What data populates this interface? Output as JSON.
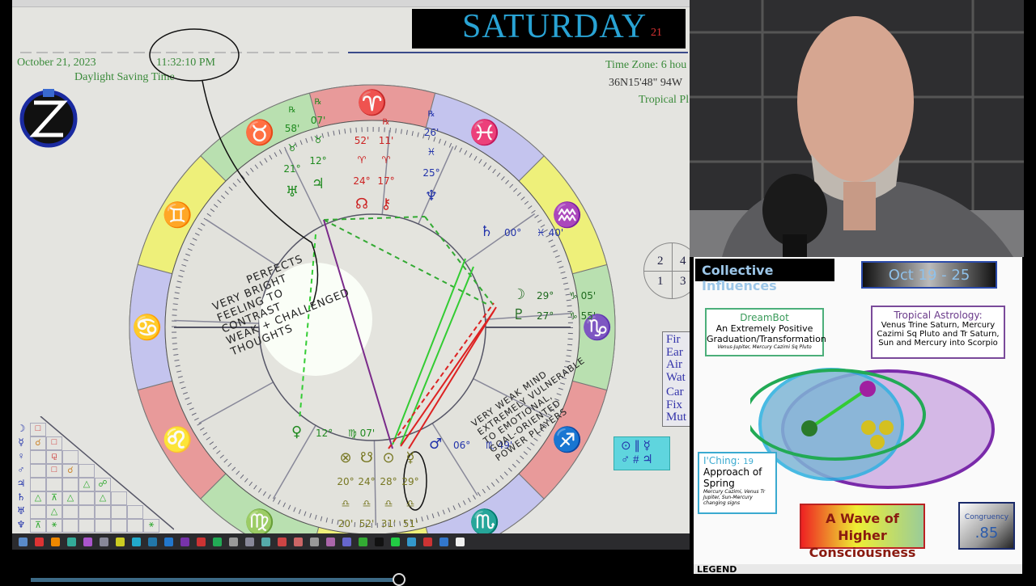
{
  "banner": {
    "day": "SATURDAY",
    "date_num": "21"
  },
  "chart_header": {
    "date": "October 21, 2023",
    "time": "11:32:10 PM",
    "dst": "Daylight Saving Time",
    "timezone": "Time Zone: 6 hou",
    "coords": "36N15'48\"  94W",
    "system": "Tropical Pl"
  },
  "signs": [
    {
      "name": "Aries",
      "glyph": "♈",
      "color": "#e89a9a",
      "glyph_color": "#cc1111"
    },
    {
      "name": "Taurus",
      "glyph": "♉",
      "color": "#b9e0b0",
      "glyph_color": "#1f8a1f"
    },
    {
      "name": "Gemini",
      "glyph": "♊",
      "color": "#eef07a",
      "glyph_color": "#1f8a1f"
    },
    {
      "name": "Cancer",
      "glyph": "♋",
      "color": "#c4c4ee",
      "glyph_color": "#2233aa"
    },
    {
      "name": "Leo",
      "glyph": "♌",
      "color": "#e89a9a",
      "glyph_color": "#cc1111"
    },
    {
      "name": "Virgo",
      "glyph": "♍",
      "color": "#b9e0b0",
      "glyph_color": "#1f8a1f"
    },
    {
      "name": "Libra",
      "glyph": "♎",
      "color": "#eef07a",
      "glyph_color": "#1f8a1f"
    },
    {
      "name": "Scorpio",
      "glyph": "♏",
      "color": "#c4c4ee",
      "glyph_color": "#2233aa"
    },
    {
      "name": "Sagittarius",
      "glyph": "♐",
      "color": "#e89a9a",
      "glyph_color": "#cc1111"
    },
    {
      "name": "Capricorn",
      "glyph": "♑",
      "color": "#b9e0b0",
      "glyph_color": "#1f8a1f"
    },
    {
      "name": "Aquarius",
      "glyph": "♒",
      "color": "#eef07a",
      "glyph_color": "#1f8a1f"
    },
    {
      "name": "Pisces",
      "glyph": "♓",
      "color": "#c4c4ee",
      "glyph_color": "#2233aa"
    }
  ],
  "planets": [
    {
      "label": "Node",
      "glyph": "☊",
      "deg": "24°",
      "sign": "♈",
      "min": "52'",
      "color": "#cc2222"
    },
    {
      "label": "Chiron",
      "glyph": "⚷",
      "deg": "17°",
      "sign": "♈",
      "min": "11'",
      "color": "#cc2222",
      "retro": "℞"
    },
    {
      "label": "Neptune",
      "glyph": "♆",
      "deg": "25°",
      "sign": "♓",
      "min": "26'",
      "color": "#2233aa",
      "retro": "℞"
    },
    {
      "label": "Jupiter",
      "glyph": "♃",
      "deg": "12°",
      "sign": "♉",
      "min": "07'",
      "color": "#1f8a1f",
      "retro": "℞"
    },
    {
      "label": "Uranus",
      "glyph": "♅",
      "deg": "21°",
      "sign": "♉",
      "min": "58'",
      "color": "#1f8a1f",
      "retro": "℞"
    },
    {
      "label": "Moon",
      "glyph": "☽",
      "deg": "29°",
      "sign": "♑",
      "min": "05'",
      "color": "#1f6a1f"
    },
    {
      "label": "Pluto",
      "glyph": "♇",
      "deg": "27°",
      "sign": "♑",
      "min": "55'",
      "color": "#1f6a1f"
    },
    {
      "label": "Fortune",
      "glyph": "⊗",
      "deg": "20°",
      "sign": "♎",
      "min": "20'",
      "color": "#777722"
    },
    {
      "label": "SNode",
      "glyph": "☋",
      "deg": "24°",
      "sign": "♎",
      "min": "52'",
      "color": "#777722"
    },
    {
      "label": "Sun",
      "glyph": "⊙",
      "deg": "28°",
      "sign": "♎",
      "min": "31'",
      "color": "#777722"
    },
    {
      "label": "Mercury",
      "glyph": "☿",
      "deg": "29°",
      "sign": "♎",
      "min": "51'",
      "color": "#777722"
    },
    {
      "label": "Mars",
      "glyph": "♂",
      "deg": "06°",
      "sign": "♏",
      "min": "49'",
      "color": "#2233aa"
    },
    {
      "label": "Venus",
      "glyph": "♀",
      "deg": "12°",
      "sign": "♍",
      "min": "07'",
      "color": "#1f8a1f"
    },
    {
      "label": "Saturn",
      "glyph": "♄",
      "deg": "00°",
      "sign": "♓",
      "min": "40'",
      "color": "#2233aa"
    }
  ],
  "notes": {
    "left": "          PERFECTS\nVERY BRIGHT\nFEELING TO\nCONTRAST\nWEAK + CHALLENGED\nTHOUGHTS",
    "right": "VERY WEAK MIND\nEXTREMELY VULNERABLE\nTO EMOTIONAL,\nGOAL-ORIENTED\nPOWER PLAYERS"
  },
  "quadrants": [
    "2",
    "4",
    "1",
    "3"
  ],
  "elements": [
    "Fir",
    "Ear",
    "Air",
    "Wat",
    "Car",
    "Fix",
    "Mut"
  ],
  "aspect_grid": {
    "rows": [
      "☽",
      "☿",
      "♀",
      "♂",
      "♃",
      "♄",
      "♅",
      "♆"
    ],
    "cells": [
      [
        "□"
      ],
      [
        "☌",
        "□"
      ],
      [
        "",
        "⚼"
      ],
      [
        "",
        "□",
        "☌"
      ],
      [
        "",
        "",
        "",
        "△",
        "☍"
      ],
      [
        "△",
        "⊼",
        "△",
        "",
        "△"
      ],
      [
        "",
        "△"
      ],
      [
        "⊼",
        "⚹",
        "",
        "",
        "",
        "",
        "",
        "⚹"
      ]
    ]
  },
  "cyan_box": {
    "line1": "⊙ ∥ ☿",
    "line2": "♂ # ♃"
  },
  "panel": {
    "title": "Collective Influences",
    "dates": "Oct 19 - 25",
    "dreambot": {
      "heading": "DreamBot",
      "body": "An Extremely Positive Graduation/Transformation",
      "sub": "Venus-Jupiter, Mercury Cazimi Sq Pluto"
    },
    "astro": {
      "heading": "Tropical Astrology:",
      "body": "Venus Trine Saturn, Mercury Cazimi Sq Pluto and Tr Saturn, Sun and Mercury into Scorpio"
    },
    "iching": {
      "heading": "I'Ching:",
      "number": "19",
      "body": "Approach of Spring",
      "sub": "Mercury Cazimi, Venus Tr Jupiter, Sun-Mercury changing signs"
    },
    "theme": "A Wave of Higher Consciousness",
    "congruency": {
      "label": "Congruency",
      "value": ".85"
    },
    "legend": "LEGEND"
  },
  "video": {
    "progress_percent": 38
  },
  "colors": {
    "accent": "#29a3d4",
    "chart_bg": "#e4e4e0"
  }
}
